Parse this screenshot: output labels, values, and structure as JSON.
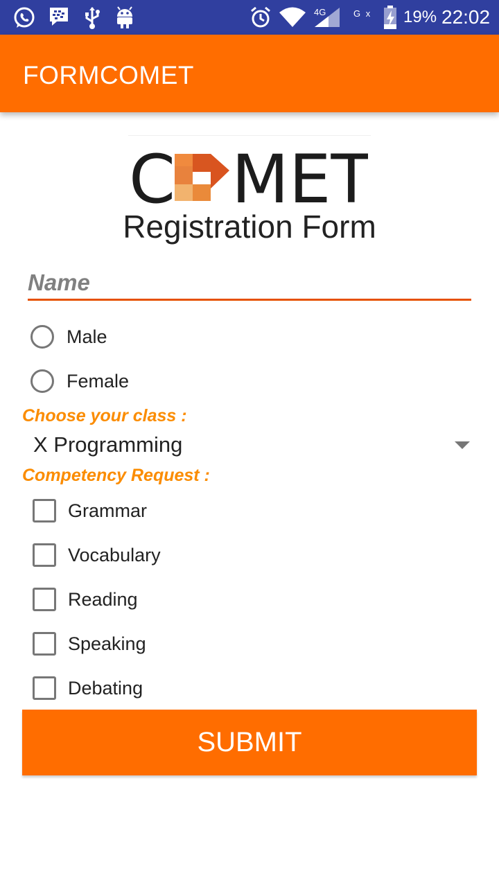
{
  "status_bar": {
    "battery": "19%",
    "time": "22:02",
    "network_type": "4G",
    "sim_label": "G x",
    "icons": [
      "whatsapp-icon",
      "bbm-icon",
      "usb-icon",
      "android-icon",
      "alarm-icon",
      "wifi-icon",
      "signal-icon",
      "battery-charging-icon"
    ]
  },
  "app_bar": {
    "title": "FORMCOMET"
  },
  "logo": {
    "text_left": "C",
    "text_right": "MET"
  },
  "form": {
    "title": "Registration Form",
    "name_placeholder": "Name",
    "gender_options": [
      "Male",
      "Female"
    ],
    "class_label": "Choose your class :",
    "class_selected": "X Programming",
    "competency_label": "Competency Request :",
    "competencies": [
      "Grammar",
      "Vocabulary",
      "Reading",
      "Speaking",
      "Debating"
    ],
    "submit_label": "SUBMIT"
  },
  "colors": {
    "status_bar": "#303f9f",
    "primary": "#ff6d00",
    "accent_label": "#fb8c00",
    "underline": "#e65100"
  }
}
